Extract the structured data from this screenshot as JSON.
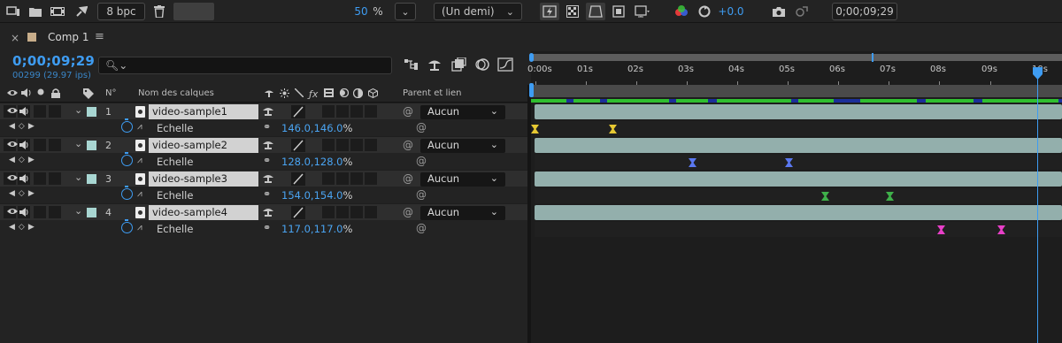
{
  "toolbar": {
    "bit_depth": "8 bpc",
    "zoom_value": "50",
    "zoom_unit": "%",
    "resolution": "(Un demi)",
    "exposure": "+0.0",
    "current_time": "0;00;09;29"
  },
  "comp": {
    "close_glyph": "×",
    "name": "Comp 1",
    "menu_glyph": "≡"
  },
  "timeline_header": {
    "timecode": "0;00;09;29",
    "frame_info": "00299 (29.97 ips)",
    "search_placeholder": "",
    "search_glyph": "🔍︎⌄"
  },
  "columns": {
    "number": "N°",
    "layer_name": "Nom des calques",
    "parent": "Parent et lien"
  },
  "layers": [
    {
      "number": "1",
      "name": "video-sample1",
      "parent": "Aucun",
      "property": "Echelle",
      "value": "146.0,146.0",
      "unit": "%",
      "keyframe_color": "#e6c832"
    },
    {
      "number": "2",
      "name": "video-sample2",
      "parent": "Aucun",
      "property": "Echelle",
      "value": "128.0,128.0",
      "unit": "%",
      "keyframe_color": "#5a78f0"
    },
    {
      "number": "3",
      "name": "video-sample3",
      "parent": "Aucun",
      "property": "Echelle",
      "value": "154.0,154.0",
      "unit": "%",
      "keyframe_color": "#3fb04a"
    },
    {
      "number": "4",
      "name": "video-sample4",
      "parent": "Aucun",
      "property": "Echelle",
      "value": "117.0,117.0",
      "unit": "%",
      "keyframe_color": "#e83fc8"
    }
  ],
  "ruler": {
    "labels": [
      "0:00s",
      "01s",
      "02s",
      "03s",
      "04s",
      "05s",
      "06s",
      "07s",
      "08s",
      "09s",
      "10s"
    ]
  },
  "colors": {
    "accent": "#3e9cf2",
    "label_aqua": "#a8d6d2",
    "layer_bar": "#93afac"
  },
  "icons": {
    "eye": "eye-icon",
    "audio": "speaker-icon",
    "solo": "solo-dot-icon",
    "lock": "lock-icon",
    "label": "tag-icon",
    "stopwatch": "stopwatch-icon",
    "graph": "graph-icon",
    "link": "link-icon",
    "pickwhip": "pickwhip-spiral-icon"
  }
}
